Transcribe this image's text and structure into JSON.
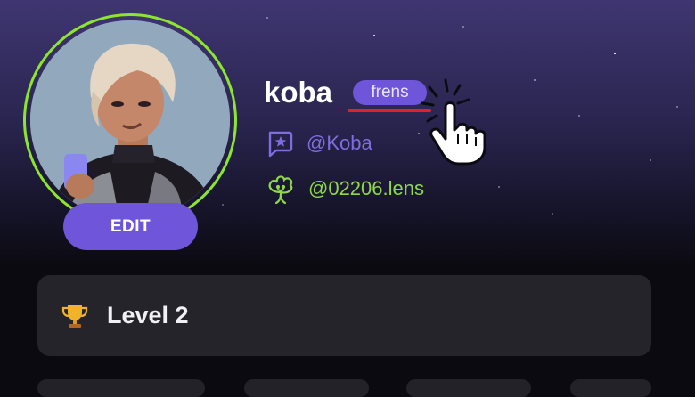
{
  "profile": {
    "username": "koba",
    "badge": "frens",
    "handle": "@Koba",
    "lens_handle": "@02206.lens",
    "edit_label": "EDIT"
  },
  "level": {
    "label": "Level 2"
  },
  "icons": {
    "handle": "message-star-icon",
    "lens": "lens-plant-icon",
    "level": "trophy-icon",
    "cursor": "pointing-hand-cursor-icon"
  },
  "colors": {
    "accent": "#6e55d9",
    "avatar_ring": "#8ee62c",
    "lens_green": "#8fd84a",
    "underline_red": "#e0202a",
    "card_bg": "#24242a"
  }
}
